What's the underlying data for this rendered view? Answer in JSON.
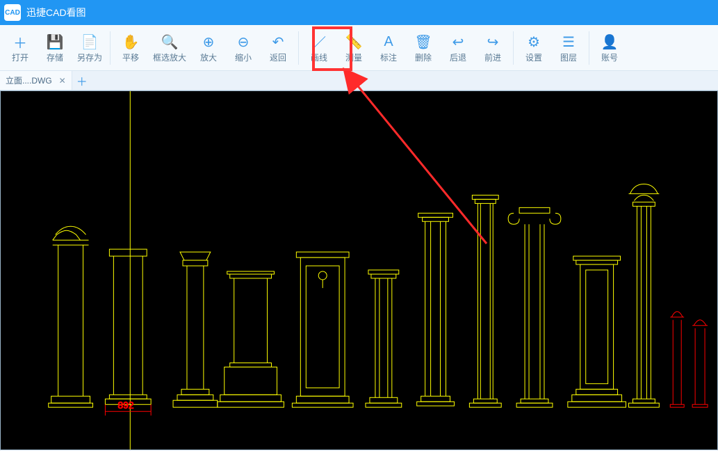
{
  "app": {
    "title": "迅捷CAD看图",
    "logo_text": "CAD"
  },
  "toolbar": {
    "open": "打开",
    "save": "存储",
    "saveas": "另存为",
    "pan": "平移",
    "zoomwindow": "框选放大",
    "zoomin": "放大",
    "zoomout": "缩小",
    "back": "返回",
    "line": "画线",
    "measure": "测量",
    "annotate": "标注",
    "delete": "删除",
    "undo": "后退",
    "redo": "前进",
    "settings": "设置",
    "layers": "图层",
    "account": "账号"
  },
  "tabs": {
    "file1": "立面....DWG"
  },
  "cad": {
    "dim1": "892"
  }
}
